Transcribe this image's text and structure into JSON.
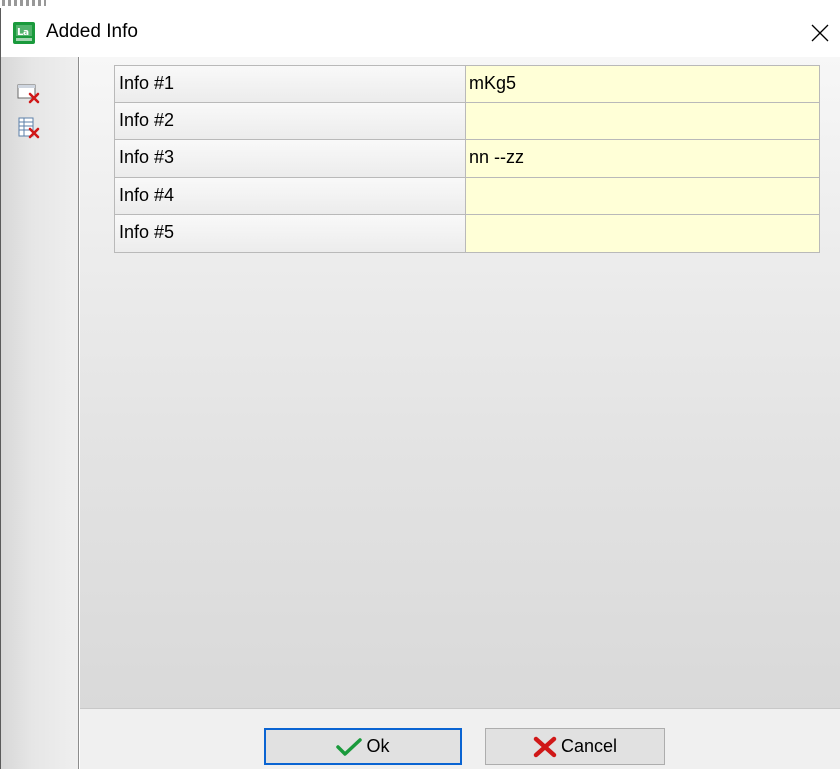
{
  "window": {
    "title": "Added Info",
    "icon": "app-logo-icon",
    "close_icon": "close-icon"
  },
  "toolbar": {
    "items": [
      {
        "icon": "delete-field-icon"
      },
      {
        "icon": "delete-table-icon"
      }
    ]
  },
  "info_table": {
    "rows": [
      {
        "label": "Info #1",
        "value": "mKg5"
      },
      {
        "label": "Info #2",
        "value": ""
      },
      {
        "label": "Info #3",
        "value": "nn --zz"
      },
      {
        "label": "Info #4",
        "value": ""
      },
      {
        "label": "Info #5",
        "value": ""
      }
    ]
  },
  "buttons": {
    "ok_label": "Ok",
    "cancel_label": "Cancel"
  },
  "colors": {
    "value_cell_bg": "#ffffd7",
    "ok_focus_border": "#0a64d2",
    "icon_green": "#1a9a3c",
    "icon_red": "#d01818"
  }
}
